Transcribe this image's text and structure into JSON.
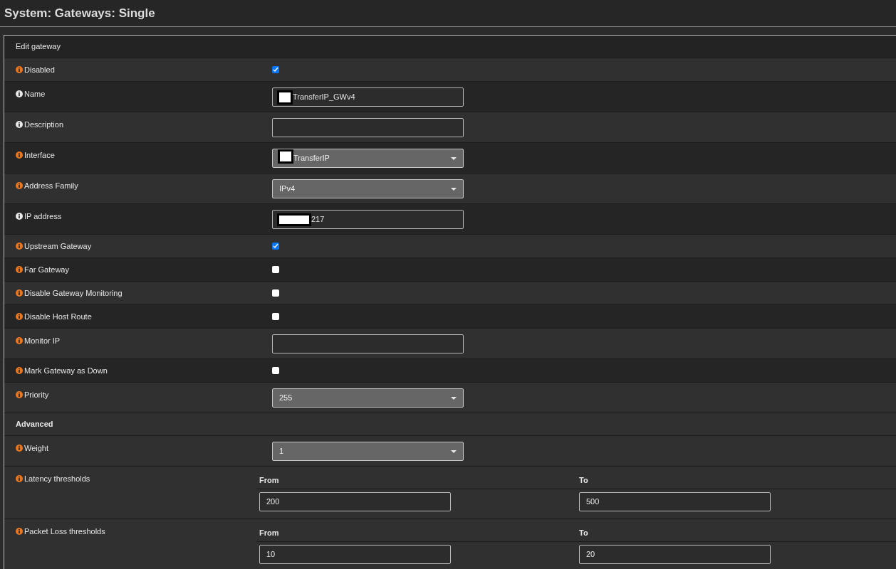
{
  "page_title": "System: Gateways: Single",
  "section_title": "Edit gateway",
  "rows": [
    {
      "kind": "checkbox",
      "label": "Disabled",
      "icon_highlight": true,
      "checked": true
    },
    {
      "kind": "text",
      "label": "Name",
      "icon_highlight": false,
      "value": "TransferIP_GWv4",
      "redacted": true
    },
    {
      "kind": "text",
      "label": "Description",
      "icon_highlight": false,
      "value": "",
      "redacted": false
    },
    {
      "kind": "select",
      "label": "Interface",
      "icon_highlight": true,
      "value": "TransferIP",
      "redacted": true
    },
    {
      "kind": "select",
      "label": "Address Family",
      "icon_highlight": true,
      "value": "IPv4",
      "redacted": false
    },
    {
      "kind": "text",
      "label": "IP address",
      "icon_highlight": false,
      "value": "217",
      "redacted": true,
      "wide_redaction": true
    },
    {
      "kind": "checkbox",
      "label": "Upstream Gateway",
      "icon_highlight": true,
      "checked": true
    },
    {
      "kind": "checkbox",
      "label": "Far Gateway",
      "icon_highlight": true,
      "checked": false
    },
    {
      "kind": "checkbox",
      "label": "Disable Gateway Monitoring",
      "icon_highlight": true,
      "checked": false
    },
    {
      "kind": "checkbox",
      "label": "Disable Host Route",
      "icon_highlight": true,
      "checked": false
    },
    {
      "kind": "text",
      "label": "Monitor IP",
      "icon_highlight": true,
      "value": "",
      "redacted": false
    },
    {
      "kind": "checkbox",
      "label": "Mark Gateway as Down",
      "icon_highlight": true,
      "checked": false
    },
    {
      "kind": "select",
      "label": "Priority",
      "icon_highlight": true,
      "value": "255",
      "redacted": false
    },
    {
      "kind": "heading",
      "label": "Advanced"
    },
    {
      "kind": "select",
      "label": "Weight",
      "icon_highlight": true,
      "value": "1",
      "redacted": false
    },
    {
      "kind": "range",
      "label": "Latency thresholds",
      "icon_highlight": true,
      "from_label": "From",
      "from_value": "200",
      "to_label": "To",
      "to_value": "500"
    },
    {
      "kind": "range",
      "label": "Packet Loss thresholds",
      "icon_highlight": true,
      "from_label": "From",
      "from_value": "10",
      "to_label": "To",
      "to_value": "20"
    }
  ]
}
